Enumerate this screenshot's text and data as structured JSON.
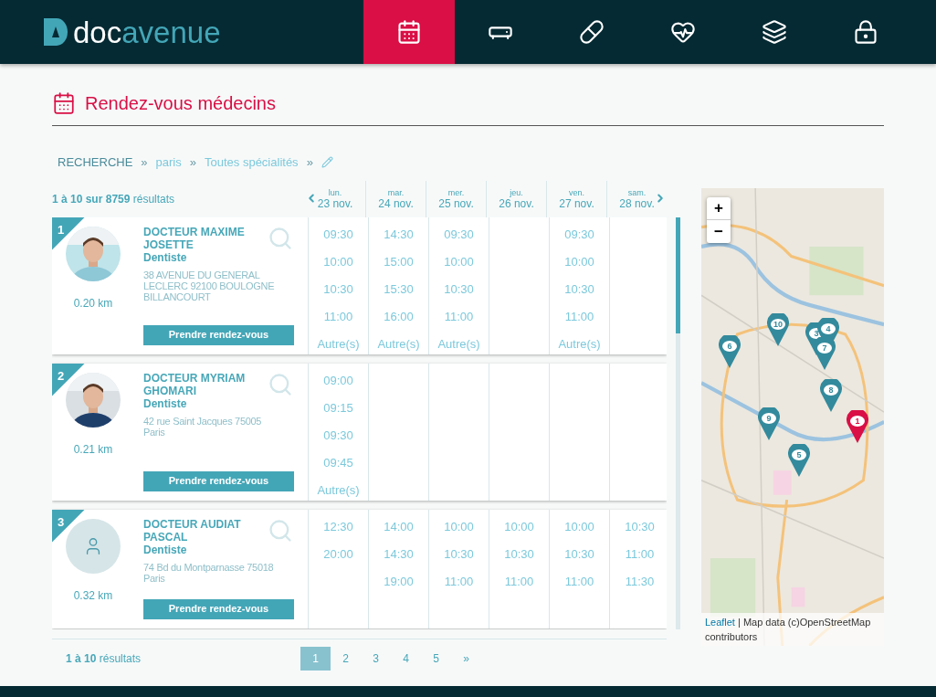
{
  "logo": {
    "lead": "doc",
    "tail": "avenue"
  },
  "nav": [
    {
      "selected": true
    },
    {
      "selected": false
    },
    {
      "selected": false
    },
    {
      "selected": false
    },
    {
      "selected": false
    },
    {
      "selected": false
    }
  ],
  "page_title": "Rendez-vous médecins",
  "breadcrumb": [
    "RECHERCHE",
    "»",
    "paris",
    "»",
    "Toutes spécialités",
    "»"
  ],
  "results_count": "**1 à 10 sur 8759** résultats",
  "days": [
    {
      "weekday": "lun.",
      "date": "23 nov."
    },
    {
      "weekday": "mar.",
      "date": "24 nov."
    },
    {
      "weekday": "mer.",
      "date": "25 nov."
    },
    {
      "weekday": "jeu.",
      "date": "26 nov."
    },
    {
      "weekday": "ven.",
      "date": "27 nov."
    },
    {
      "weekday": "sam.",
      "date": "28 nov."
    }
  ],
  "doctors": [
    {
      "rank": "1",
      "name": "DOCTEUR MAXIME JOSETTE",
      "specialty": "Dentiste",
      "address": "38 AVENUE DU GENERAL LECLERC 92100 BOULOGNE BILLANCOURT",
      "distance": "0.20 km",
      "button": "Prendre rendez-vous",
      "slots": [
        {
          "kind": "times",
          "times": [
            "09:30",
            "10:00",
            "10:30",
            "11:00"
          ],
          "more": "Autre(s)"
        },
        {
          "kind": "times",
          "times": [
            "14:30",
            "15:00",
            "15:30",
            "16:00"
          ],
          "more": "Autre(s)"
        },
        {
          "kind": "times",
          "times": [
            "09:30",
            "10:00",
            "10:30",
            "11:00"
          ],
          "more": "Autre(s)"
        },
        {
          "kind": "empty"
        },
        {
          "kind": "times",
          "times": [
            "09:30",
            "10:00",
            "10:30",
            "11:00"
          ],
          "more": "Autre(s)"
        },
        {
          "kind": "empty"
        }
      ]
    },
    {
      "rank": "2",
      "name": "DOCTEUR MYRIAM GHOMARI",
      "specialty": "Dentiste",
      "address": "42 rue Saint Jacques 75005 Paris",
      "distance": "0.21 km",
      "button": "Prendre rendez-vous",
      "slots": [
        {
          "kind": "times",
          "times": [
            "09:00",
            "09:15",
            "09:30",
            "09:45"
          ],
          "more": "Autre(s)"
        },
        {
          "kind": "empty"
        },
        {
          "kind": "empty"
        },
        {
          "kind": "empty"
        },
        {
          "kind": "empty"
        },
        {
          "kind": "empty"
        }
      ]
    },
    {
      "rank": "3",
      "avatar": {
        "kind": "placeholder"
      },
      "name": "DOCTEUR AUDIAT PASCAL",
      "specialty": "Dentiste",
      "address": "74 Bd du Montparnasse 75018 Paris",
      "distance": "0.32 km",
      "button": "Prendre rendez-vous",
      "slots": [
        {
          "kind": "times",
          "times": [
            "12:30",
            "20:00"
          ]
        },
        {
          "kind": "times",
          "times": [
            "14:00",
            "14:30",
            "19:00"
          ]
        },
        {
          "kind": "times",
          "times": [
            "10:00",
            "10:30",
            "11:00"
          ]
        },
        {
          "kind": "times",
          "times": [
            "10:00",
            "10:30",
            "11:00"
          ]
        },
        {
          "kind": "times",
          "times": [
            "10:00",
            "10:30",
            "11:00"
          ]
        },
        {
          "kind": "times",
          "times": [
            "10:30",
            "11:00",
            "11:30"
          ]
        }
      ]
    }
  ],
  "pagination": {
    "summary": "**1 à 10** résultats",
    "pages": [
      {
        "label": "1",
        "selected": true
      },
      {
        "label": "2",
        "selected": false
      },
      {
        "label": "3",
        "selected": false
      },
      {
        "label": "4",
        "selected": false
      },
      {
        "label": "5",
        "selected": false
      },
      {
        "label": "»",
        "selected": false
      }
    ]
  },
  "map": {
    "zoom_in": "+",
    "zoom_out": "−",
    "attribution_link": "Leaflet",
    "attribution": "| Map data (c)OpenStreetMap contributors",
    "markers": [
      {
        "label": "1",
        "selected": true
      },
      {
        "label": "3",
        "selected": false
      },
      {
        "label": "4",
        "selected": false
      },
      {
        "label": "5",
        "selected": false
      },
      {
        "label": "6",
        "selected": false
      },
      {
        "label": "7",
        "selected": false
      },
      {
        "label": "8",
        "selected": false
      },
      {
        "label": "9",
        "selected": false
      },
      {
        "label": "10",
        "selected": false
      }
    ]
  }
}
